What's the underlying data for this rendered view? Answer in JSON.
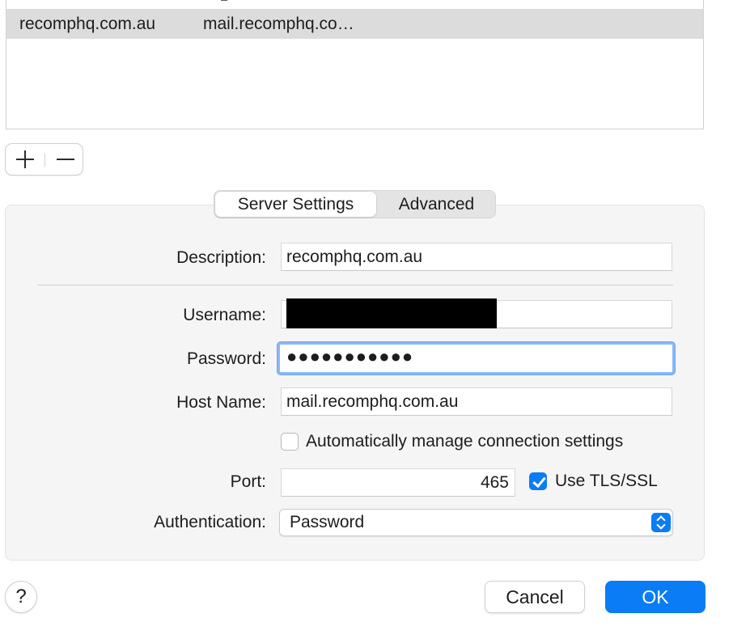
{
  "server_list": {
    "rows": [
      {
        "account": "recomphq.com.au",
        "server": "mail.recomphq.co…",
        "selected": true
      }
    ]
  },
  "list_controls": {
    "add_icon": "plus-icon",
    "remove_icon": "minus-icon"
  },
  "tabs": [
    {
      "label": "Server Settings",
      "selected": true
    },
    {
      "label": "Advanced",
      "selected": false
    }
  ],
  "form": {
    "description": {
      "label": "Description:",
      "value": "recomphq.com.au"
    },
    "username": {
      "label": "Username:",
      "value": "",
      "redacted": true
    },
    "password": {
      "label": "Password:",
      "value": "●●●●●●●●●●●",
      "focused": true
    },
    "host_name": {
      "label": "Host Name:",
      "value": "mail.recomphq.com.au"
    },
    "auto_manage": {
      "label": "Automatically manage connection settings",
      "checked": false
    },
    "port": {
      "label": "Port:",
      "value": "465"
    },
    "use_tls": {
      "label": "Use TLS/SSL",
      "checked": true
    },
    "authentication": {
      "label": "Authentication:",
      "value": "Password",
      "icon": "updown-chevron-icon"
    }
  },
  "buttons": {
    "help": "?",
    "cancel": "Cancel",
    "ok": "OK"
  },
  "colors": {
    "accent": "#0a7cf5",
    "selected_row": "#dcdcdc",
    "panel_bg": "#f5f5f5",
    "focus_ring": "#8ab8f5"
  }
}
